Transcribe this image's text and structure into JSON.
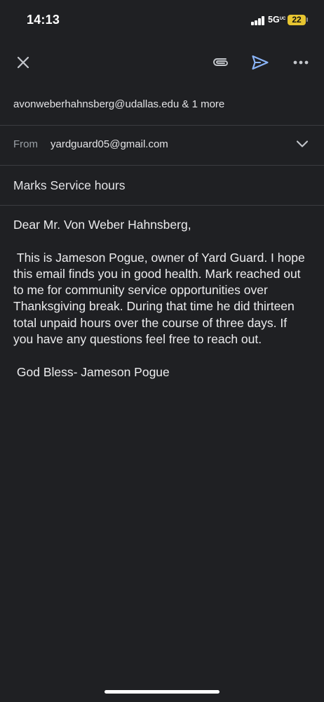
{
  "status_bar": {
    "time": "14:13",
    "network": "5G",
    "network_suffix": "UC",
    "battery": "22"
  },
  "toolbar": {
    "close_icon": "close-icon",
    "attach_icon": "paperclip-icon",
    "send_icon": "send-icon",
    "more_icon": "more-horizontal-icon",
    "send_color": "#8ab4f8"
  },
  "compose": {
    "to": "avonweberhahnsberg@udallas.edu & 1 more",
    "from_label": "From",
    "from": "yardguard05@gmail.com",
    "subject": "Marks Service hours",
    "greeting": "Dear Mr. Von Weber Hahnsberg,",
    "paragraph": " This is Jameson Pogue, owner of Yard Guard. I hope this email finds you in good health. Mark reached out to me for community service opportunities over Thanksgiving break. During that time he did thirteen total unpaid hours over the course of three days. If you have any questions feel free to reach out.",
    "signoff": " God Bless- Jameson Pogue"
  }
}
